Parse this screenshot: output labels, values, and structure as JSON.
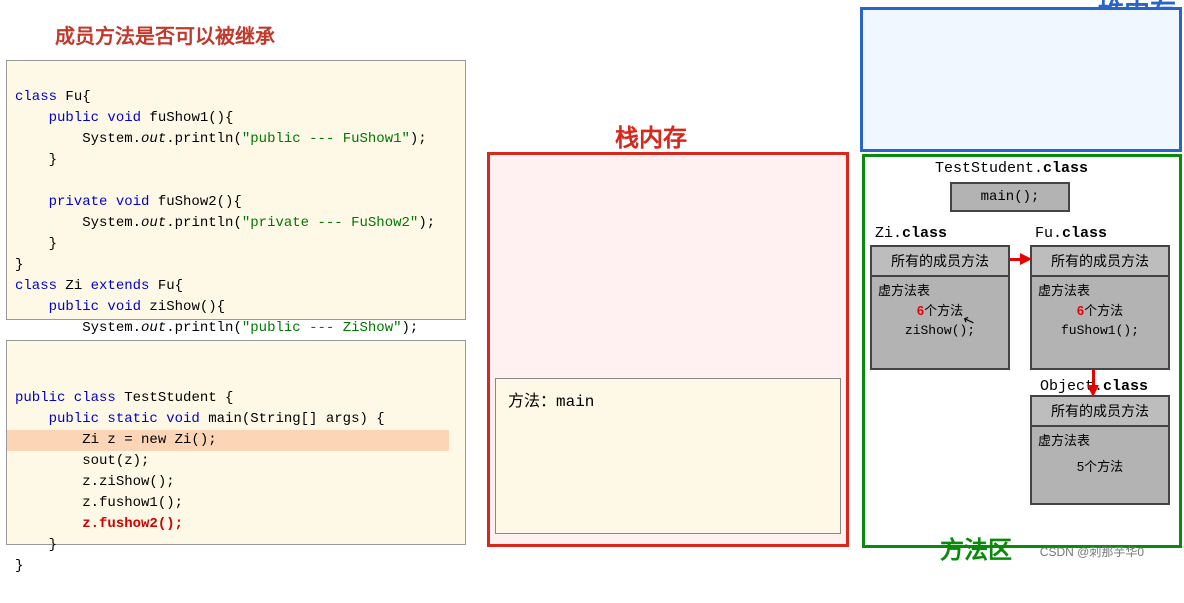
{
  "title": "成员方法是否可以被继承",
  "stack_label": "栈内存",
  "heap_label_partial": "堆内存",
  "method_area_label": "方法区",
  "watermark": "CSDN @刺那芋华0",
  "code1": {
    "l1a": "class",
    "l1b": " Fu{",
    "l2a": "    public void",
    "l2b": " fuShow1(){",
    "l3a": "        System.",
    "l3b": "out",
    "l3c": ".println(",
    "l3d": "\"public --- FuShow1\"",
    "l3e": ");",
    "l4": "    }",
    "l5": "",
    "l6a": "    private void",
    "l6b": " fuShow2(){",
    "l7a": "        System.",
    "l7b": "out",
    "l7c": ".println(",
    "l7d": "\"private --- FuShow2\"",
    "l7e": ");",
    "l8": "    }",
    "l9": "}",
    "l10a": "class",
    "l10b": " Zi ",
    "l10c": "extends",
    "l10d": " Fu{",
    "l11a": "    public void",
    "l11b": " ziShow(){",
    "l12a": "        System.",
    "l12b": "out",
    "l12c": ".println(",
    "l12d": "\"public --- ZiShow\"",
    "l12e": ");",
    "l13": "    }",
    "l14": "}"
  },
  "code2": {
    "l1a": "public class",
    "l1b": " TestStudent {",
    "l2a": "    public static void",
    "l2b": " main(String[] args) {",
    "l3": "        Zi z = new Zi();",
    "l4": "        sout(z);",
    "l5": "        z.ziShow();",
    "l6": "        z.fushow1();",
    "l7": "        z.fushow2();",
    "l8": "    }",
    "l9": "}"
  },
  "stack_frame": "方法：main",
  "method_area": {
    "teststudent_label_a": "TestStudent.",
    "teststudent_label_b": "class",
    "main_call": "main();",
    "zi_label_a": "Zi.",
    "zi_label_b": "class",
    "fu_label_a": "Fu.",
    "fu_label_b": "class",
    "object_label_a": "Object.",
    "object_label_b": "class",
    "all_member_methods": "所有的成员方法",
    "vtable": "虚方法表",
    "zi_count": "6",
    "zi_count_suffix": "个方法",
    "zi_method": "ziShow();",
    "fu_count": "6",
    "fu_count_suffix": "个方法",
    "fu_method": "fuShow1();",
    "obj_count": "5个方法"
  }
}
